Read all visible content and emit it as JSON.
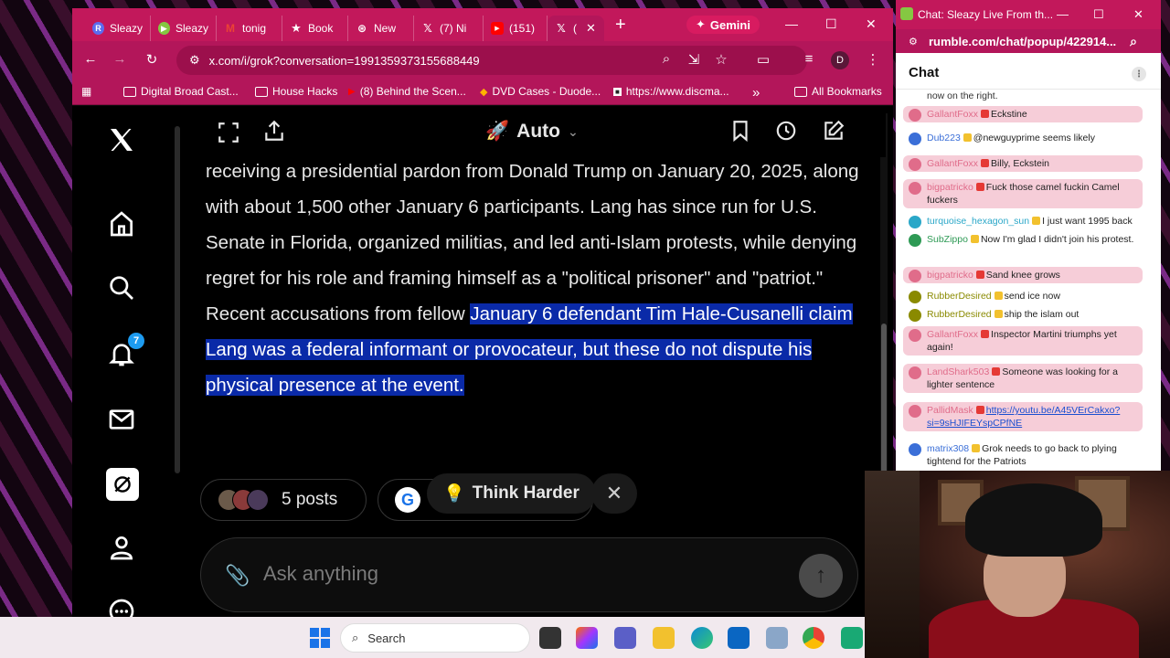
{
  "browser": {
    "tabs": [
      {
        "label": "Sleazy",
        "icon": "rumble-r-icon",
        "color": "#5b6cf0"
      },
      {
        "label": "Sleazy",
        "icon": "rumble-icon",
        "color": "#85c742"
      },
      {
        "label": "tonig",
        "icon": "gmail-icon",
        "color": "#ea4335"
      },
      {
        "label": "Book",
        "icon": "star-icon",
        "color": "#ffffff"
      },
      {
        "label": "New",
        "icon": "chatgpt-icon",
        "color": "#ffffff"
      },
      {
        "label": "(7) Ni",
        "icon": "x-logo-icon",
        "color": "#ffffff"
      },
      {
        "label": "(151)",
        "icon": "youtube-icon",
        "color": "#ff0000"
      },
      {
        "label": "(",
        "icon": "x-logo-icon",
        "color": "#ffffff"
      }
    ],
    "new_tab": "+",
    "gemini_label": "Gemini",
    "url": "x.com/i/grok?conversation=1991359373155688449",
    "profile_initial": "D",
    "bookmarks": [
      {
        "label": "Digital Broad Cast...",
        "icon": "folder-icon"
      },
      {
        "label": "House Hacks",
        "icon": "folder-icon"
      },
      {
        "label": "(8) Behind the Scen...",
        "icon": "youtube-icon"
      },
      {
        "label": "DVD Cases - Duode...",
        "icon": "site-icon"
      },
      {
        "label": "https://www.discma...",
        "icon": "site-icon"
      }
    ],
    "bookmarks_overflow": "»",
    "all_bookmarks": "All Bookmarks"
  },
  "x": {
    "notification_count": "7",
    "mode_label": "Auto",
    "answer_plain": "receiving a presidential pardon from Donald Trump on January 20, 2025, along with about 1,500 other January 6 participants. Lang has since run for U.S. Senate in Florida, organized militias, and led anti-Islam protests, while denying regret for his role and framing himself as a \"political prisoner\" and \"patriot.\" Recent accusations from fellow ",
    "answer_highlight": "January 6 defendant Tim Hale-Cusanelli claim Lang was a federal informant or provocateur, but these do not dispute his physical presence at the event.",
    "posts_label": "5 posts",
    "think_harder_label": "Think Harder",
    "composer_placeholder": "Ask anything"
  },
  "chat": {
    "window_title": "Chat: Sleazy Live From th...",
    "url": "rumble.com/chat/popup/422914...",
    "header": "Chat",
    "top_fragment": "now on the right.",
    "messages": [
      {
        "user": "GallantFoxx",
        "text": "Eckstine",
        "highlight": true,
        "color": "#e06c8a"
      },
      {
        "user": "Dub223",
        "text": "@newguyprime seems likely",
        "highlight": false,
        "color": "#3b6fd8"
      },
      {
        "user": "GallantFoxx",
        "text": "Billy, Eckstein",
        "highlight": true,
        "color": "#e06c8a"
      },
      {
        "user": "bigpatricko",
        "text": "Fuck those camel fuckin Camel fuckers",
        "highlight": true,
        "color": "#e06c8a"
      },
      {
        "user": "turquoise_hexagon_sun",
        "text": "I just want 1995 back",
        "highlight": false,
        "color": "#2aa7c8"
      },
      {
        "user": "SubZippo",
        "text": "Now I'm glad I didn't join his protest.",
        "highlight": false,
        "color": "#2e9a55"
      },
      {
        "user": "bigpatricko",
        "text": "Sand knee grows",
        "highlight": true,
        "color": "#e06c8a"
      },
      {
        "user": "RubberDesired",
        "text": "send ice now",
        "highlight": false,
        "color": "#8a8a00"
      },
      {
        "user": "RubberDesired",
        "text": "ship the islam out",
        "highlight": false,
        "color": "#8a8a00"
      },
      {
        "user": "GallantFoxx",
        "text": "Inspector Martini triumphs yet again!",
        "highlight": true,
        "color": "#e06c8a"
      },
      {
        "user": "LandShark503",
        "text": "Someone was looking for a lighter sentence",
        "highlight": true,
        "color": "#e06c8a"
      },
      {
        "user": "PallidMask",
        "text": "https://youtu.be/A45VErCakxo?si=9sHJIFEYspCPfNE",
        "highlight": true,
        "color": "#e06c8a"
      },
      {
        "user": "matrix308",
        "text": "Grok needs to go back to plying tightend for the Patriots",
        "highlight": false,
        "color": "#3b6fd8"
      }
    ]
  },
  "taskbar": {
    "search_label": "Search"
  },
  "colors": {
    "chrome_accent": "#c2185b",
    "x_highlight": "#0a2aa8",
    "x_badge": "#1d9bf0"
  }
}
